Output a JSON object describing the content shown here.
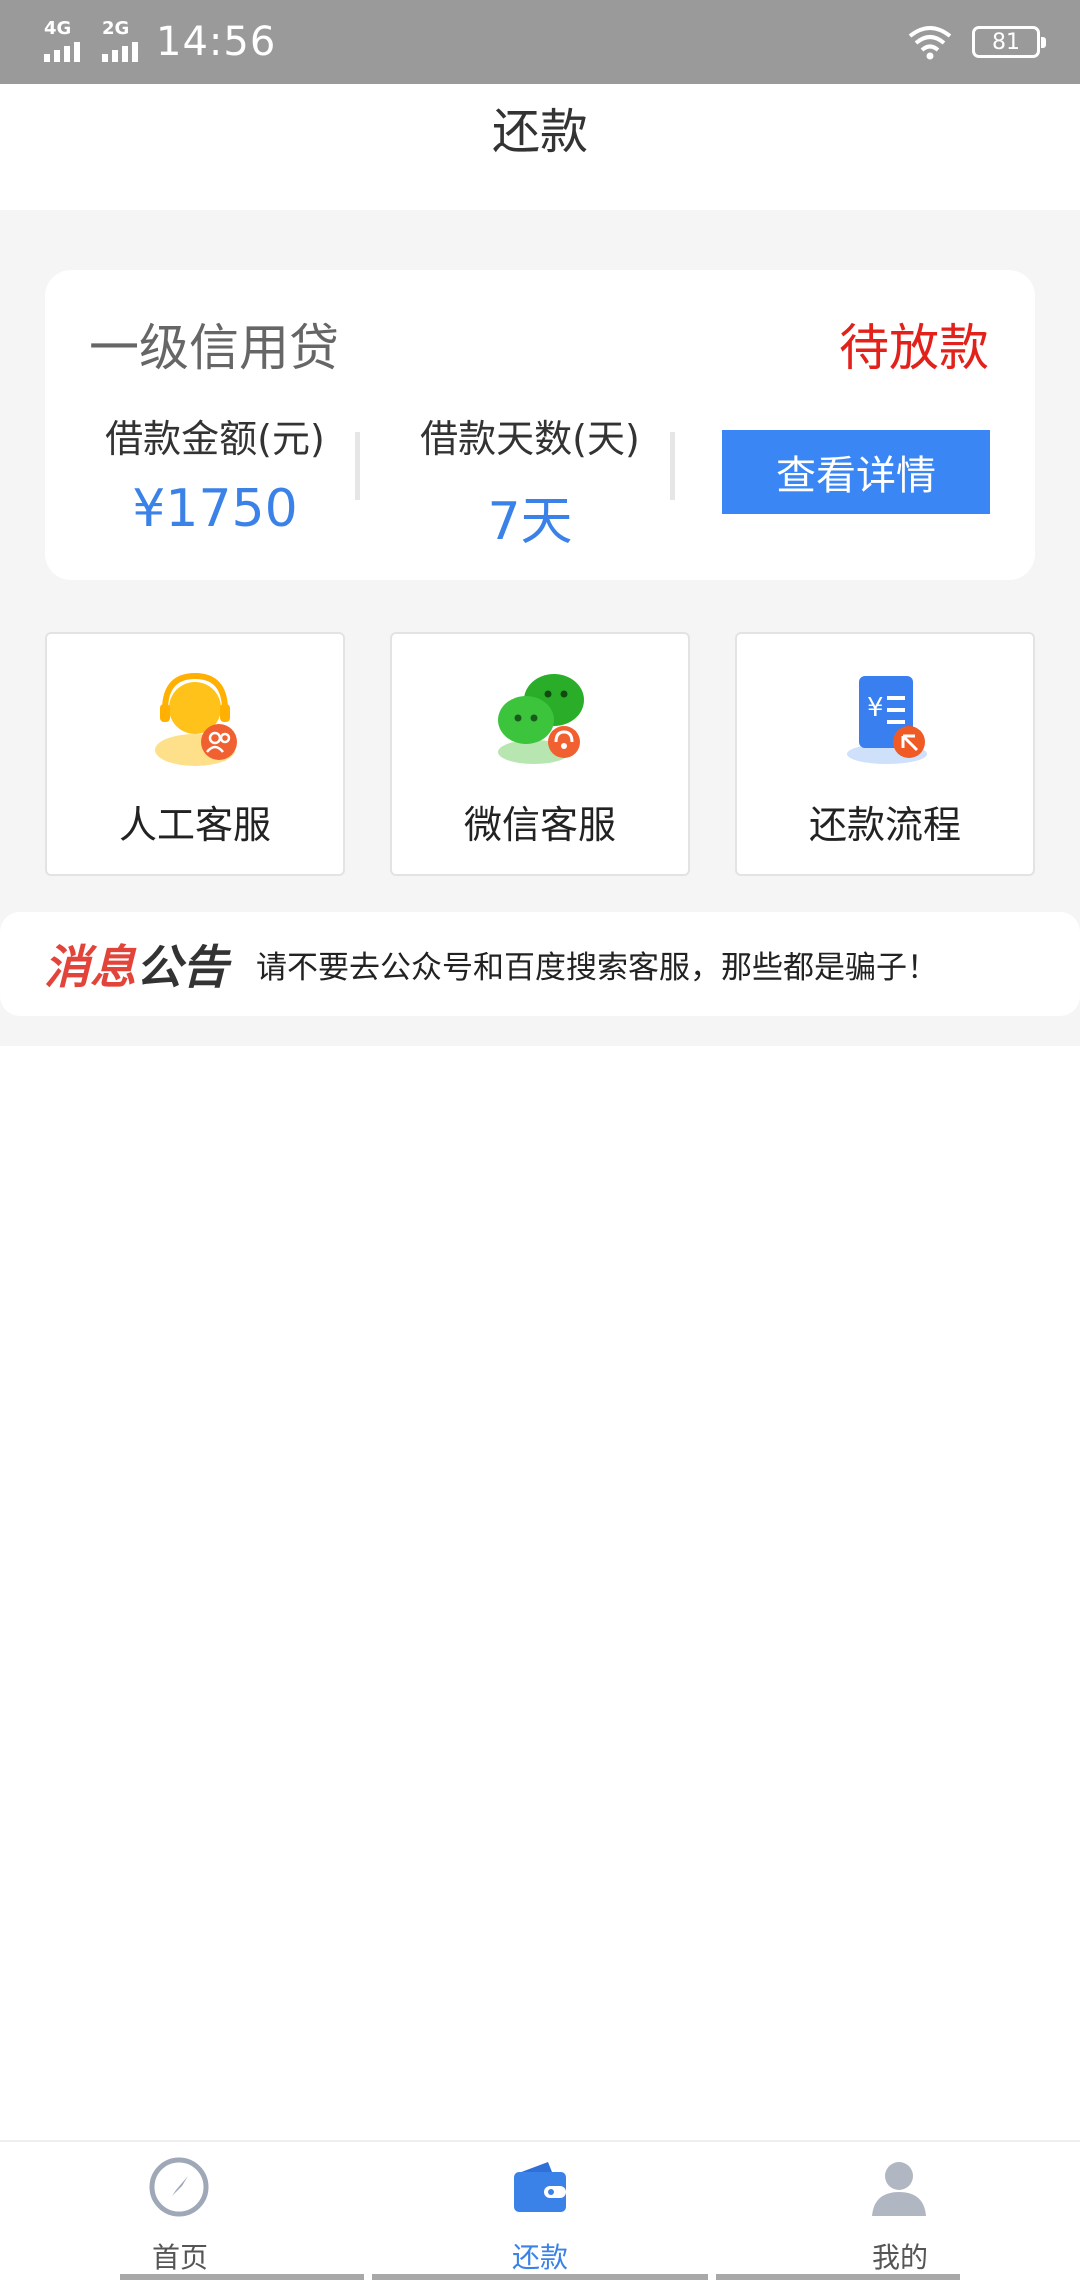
{
  "status_bar": {
    "network_1": "4G",
    "network_2": "2G",
    "time": "14:56",
    "battery": "81"
  },
  "header": {
    "title": "还款"
  },
  "loan_card": {
    "name": "一级信用贷",
    "status": "待放款",
    "amount_label": "借款金额(元)",
    "amount_value": "¥1750",
    "days_label": "借款天数(天)",
    "days_value": "7天",
    "detail_button": "查看详情"
  },
  "services": [
    {
      "label": "人工客服",
      "icon": "customer-service-icon"
    },
    {
      "label": "微信客服",
      "icon": "wechat-icon"
    },
    {
      "label": "还款流程",
      "icon": "repayment-process-icon"
    }
  ],
  "notice": {
    "tag_part1": "消息",
    "tag_part2": "公告",
    "text": "请不要去公众号和百度搜索客服，那些都是骗子！"
  },
  "bottom_nav": [
    {
      "label": "首页",
      "icon": "compass-icon",
      "active": false
    },
    {
      "label": "还款",
      "icon": "wallet-icon",
      "active": true
    },
    {
      "label": "我的",
      "icon": "user-icon",
      "active": false
    }
  ],
  "colors": {
    "accent": "#3a82e8",
    "status_red": "#e3211b",
    "button_blue": "#3a86f5"
  }
}
